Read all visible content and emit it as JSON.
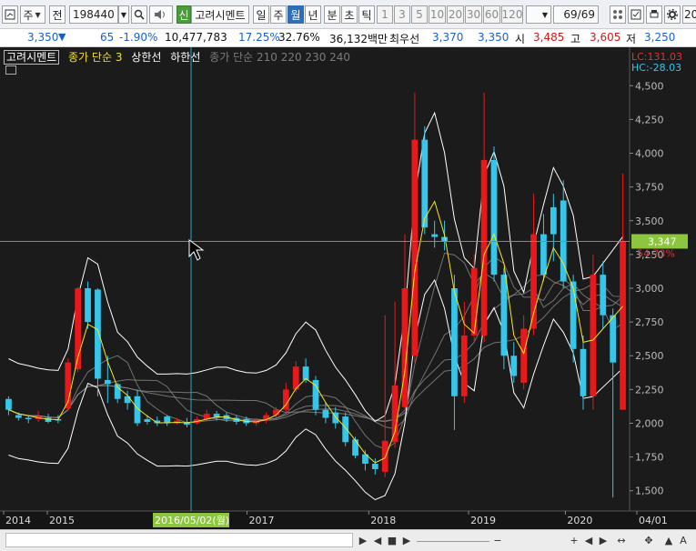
{
  "toolbar": {
    "market_label": "주",
    "period_label": "전",
    "code": "198440",
    "new_label": "신",
    "stock_name": "고려시멘트",
    "periods": [
      "일",
      "주",
      "월",
      "년"
    ],
    "active_period": "월",
    "minutes": [
      "분",
      "초",
      "틱"
    ],
    "intervals": [
      "1",
      "3",
      "5",
      "10",
      "20",
      "30",
      "60",
      "120"
    ],
    "page_count": "69/69",
    "right_partial": "20"
  },
  "quote": {
    "price": "3,350",
    "change_arrow": "▼",
    "change": "65",
    "change_pct": "-1.90%",
    "volume": "10,477,783",
    "turnover_pct": "17.25%",
    "vol_ratio": "32.76%",
    "amount": "36,132백만",
    "best_ask_label": "최우선",
    "best_ask": "3,370",
    "best_bid": "3,350",
    "open_label": "시",
    "open": "3,485",
    "high_label": "고",
    "high": "3,605",
    "low_label": "저",
    "low": "3,250"
  },
  "legend": {
    "name": "고려시멘트",
    "close_ma": "종가 단순 3",
    "upper": "상한선",
    "lower": "하한선",
    "ma_group": "종가 단순 210  220  230  240"
  },
  "annotations": {
    "lc": "LC:131.03",
    "hc": "HC:-28.03",
    "crosshair_price": "3,347",
    "crosshair_pct": "54.73%",
    "crosshair_date": "2016/05/02(월)"
  },
  "colors": {
    "background": "#1b1b1b",
    "up": "#e8191b",
    "down": "#35c6ea",
    "ma3": "#f5e52a",
    "bands": "#ffffff",
    "long_ma": "#888888",
    "crosshair": "#2aa7c9",
    "price_tag": "#8cc63f"
  },
  "chart_data": {
    "type": "candlestick",
    "x_labels": [
      "2014",
      "2015",
      "2017",
      "2018",
      "2019",
      "2020",
      "04/01"
    ],
    "y_ticks": [
      4500,
      4250,
      4000,
      3750,
      3500,
      3250,
      3000,
      2750,
      2500,
      2250,
      2000,
      1750,
      1500
    ],
    "ylim": [
      1350,
      4650
    ],
    "candles": [
      {
        "o": 2180,
        "c": 2100,
        "h": 2200,
        "l": 2060
      },
      {
        "o": 2060,
        "c": 2040,
        "h": 2080,
        "l": 2020
      },
      {
        "o": 2040,
        "c": 2030,
        "h": 2060,
        "l": 2000
      },
      {
        "o": 2030,
        "c": 2050,
        "h": 2090,
        "l": 2010
      },
      {
        "o": 2040,
        "c": 2010,
        "h": 2070,
        "l": 2000
      },
      {
        "o": 2030,
        "c": 2020,
        "h": 2060,
        "l": 2000
      },
      {
        "o": 2110,
        "c": 2450,
        "h": 2480,
        "l": 2090
      },
      {
        "o": 2400,
        "c": 3000,
        "h": 3010,
        "l": 2380
      },
      {
        "o": 3000,
        "c": 2750,
        "h": 3050,
        "l": 2700
      },
      {
        "o": 2990,
        "c": 2330,
        "h": 3000,
        "l": 2200
      },
      {
        "o": 2320,
        "c": 2290,
        "h": 2500,
        "l": 2150
      },
      {
        "o": 2290,
        "c": 2180,
        "h": 2300,
        "l": 2150
      },
      {
        "o": 2200,
        "c": 2150,
        "h": 2240,
        "l": 2100
      },
      {
        "o": 2200,
        "c": 2000,
        "h": 2250,
        "l": 1980
      },
      {
        "o": 2030,
        "c": 2010,
        "h": 2060,
        "l": 1990
      },
      {
        "o": 2020,
        "c": 2000,
        "h": 2050,
        "l": 1980
      },
      {
        "o": 2050,
        "c": 2000,
        "h": 2060,
        "l": 1980
      },
      {
        "o": 2000,
        "c": 2020,
        "h": 2040,
        "l": 1990
      },
      {
        "o": 2010,
        "c": 1990,
        "h": 2040,
        "l": 1970
      },
      {
        "o": 2000,
        "c": 2030,
        "h": 2050,
        "l": 1990
      },
      {
        "o": 2030,
        "c": 2070,
        "h": 2100,
        "l": 2020
      },
      {
        "o": 2070,
        "c": 2040,
        "h": 2090,
        "l": 2020
      },
      {
        "o": 2060,
        "c": 2030,
        "h": 2080,
        "l": 2010
      },
      {
        "o": 2040,
        "c": 2010,
        "h": 2060,
        "l": 1990
      },
      {
        "o": 2030,
        "c": 2000,
        "h": 2050,
        "l": 1980
      },
      {
        "o": 2000,
        "c": 2020,
        "h": 2040,
        "l": 1980
      },
      {
        "o": 2020,
        "c": 2060,
        "h": 2080,
        "l": 2000
      },
      {
        "o": 2060,
        "c": 2100,
        "h": 2120,
        "l": 2040
      },
      {
        "o": 2100,
        "c": 2250,
        "h": 2300,
        "l": 2080
      },
      {
        "o": 2250,
        "c": 2420,
        "h": 2460,
        "l": 2230
      },
      {
        "o": 2420,
        "c": 2320,
        "h": 2480,
        "l": 2300
      },
      {
        "o": 2320,
        "c": 2100,
        "h": 2350,
        "l": 2060
      },
      {
        "o": 2100,
        "c": 2040,
        "h": 2150,
        "l": 2000
      },
      {
        "o": 2080,
        "c": 2000,
        "h": 2120,
        "l": 1960
      },
      {
        "o": 2050,
        "c": 1860,
        "h": 2080,
        "l": 1830
      },
      {
        "o": 1880,
        "c": 1760,
        "h": 1900,
        "l": 1740
      },
      {
        "o": 1770,
        "c": 1700,
        "h": 1800,
        "l": 1650
      },
      {
        "o": 1700,
        "c": 1660,
        "h": 1740,
        "l": 1620
      },
      {
        "o": 1640,
        "c": 1870,
        "h": 2800,
        "l": 1600
      },
      {
        "o": 1860,
        "c": 2280,
        "h": 2900,
        "l": 1820
      },
      {
        "o": 2120,
        "c": 3000,
        "h": 3400,
        "l": 2100
      },
      {
        "o": 2500,
        "c": 4100,
        "h": 4450,
        "l": 2450
      },
      {
        "o": 4100,
        "c": 3450,
        "h": 4200,
        "l": 3400
      },
      {
        "o": 3400,
        "c": 3380,
        "h": 3500,
        "l": 3300
      },
      {
        "o": 3380,
        "c": 3350,
        "h": 3500,
        "l": 3280
      },
      {
        "o": 3000,
        "c": 2200,
        "h": 3100,
        "l": 1950
      },
      {
        "o": 2200,
        "c": 2650,
        "h": 2900,
        "l": 2150
      },
      {
        "o": 2650,
        "c": 3150,
        "h": 3250,
        "l": 2600
      },
      {
        "o": 2650,
        "c": 3950,
        "h": 4450,
        "l": 2600
      },
      {
        "o": 3950,
        "c": 3100,
        "h": 4050,
        "l": 3050
      },
      {
        "o": 3100,
        "c": 2500,
        "h": 3150,
        "l": 2400
      },
      {
        "o": 2500,
        "c": 2350,
        "h": 2600,
        "l": 2300
      },
      {
        "o": 2300,
        "c": 2700,
        "h": 2800,
        "l": 2250
      },
      {
        "o": 2700,
        "c": 3400,
        "h": 3700,
        "l": 2650
      },
      {
        "o": 3400,
        "c": 3100,
        "h": 3550,
        "l": 3050
      },
      {
        "o": 3600,
        "c": 3400,
        "h": 3700,
        "l": 3200
      },
      {
        "o": 3650,
        "c": 3050,
        "h": 3800,
        "l": 3000
      },
      {
        "o": 3050,
        "c": 2550,
        "h": 3100,
        "l": 2450
      },
      {
        "o": 2550,
        "c": 2200,
        "h": 2650,
        "l": 2100
      },
      {
        "o": 2200,
        "c": 3100,
        "h": 3250,
        "l": 2100
      },
      {
        "o": 3100,
        "c": 2800,
        "h": 3200,
        "l": 2700
      },
      {
        "o": 2800,
        "c": 2450,
        "h": 2850,
        "l": 1450
      },
      {
        "o": 2100,
        "c": 3350,
        "h": 3850,
        "l": 2100
      }
    ]
  }
}
